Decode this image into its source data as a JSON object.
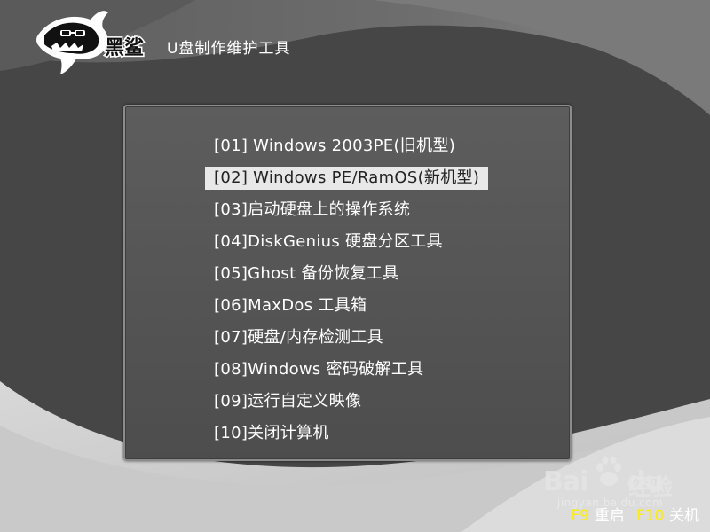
{
  "brand": {
    "logo_text": "黑鲨",
    "app_title": "U盘制作维护工具"
  },
  "menu": {
    "selected_index": 1,
    "items": [
      {
        "label": "[01] Windows 2003PE(旧机型)"
      },
      {
        "label": "[02] Windows PE/RamOS(新机型)"
      },
      {
        "label": "[03]启动硬盘上的操作系统"
      },
      {
        "label": "[04]DiskGenius 硬盘分区工具"
      },
      {
        "label": "[05]Ghost 备份恢复工具"
      },
      {
        "label": "[06]MaxDos 工具箱"
      },
      {
        "label": "[07]硬盘/内存检测工具"
      },
      {
        "label": "[08]Windows 密码破解工具"
      },
      {
        "label": "[09]运行自定义映像"
      },
      {
        "label": "[10]关闭计算机"
      }
    ]
  },
  "footer": {
    "f9_key": "F9",
    "f9_label": "重启",
    "f10_key": "F10",
    "f10_label": "关机"
  },
  "watermark": {
    "brand": "Bai",
    "brand_suffix": "du",
    "jingyan": "经验",
    "url": "jingyan.baidu.com"
  },
  "colors": {
    "background": "#4a4a4a",
    "panel_border": "#8c8c8c",
    "selection": "#e8e8e8",
    "hotkey": "#ffee00",
    "text": "#ffffff"
  },
  "icons": {
    "logo": "shark-logo-icon",
    "watermark": "baidu-paw-icon"
  }
}
